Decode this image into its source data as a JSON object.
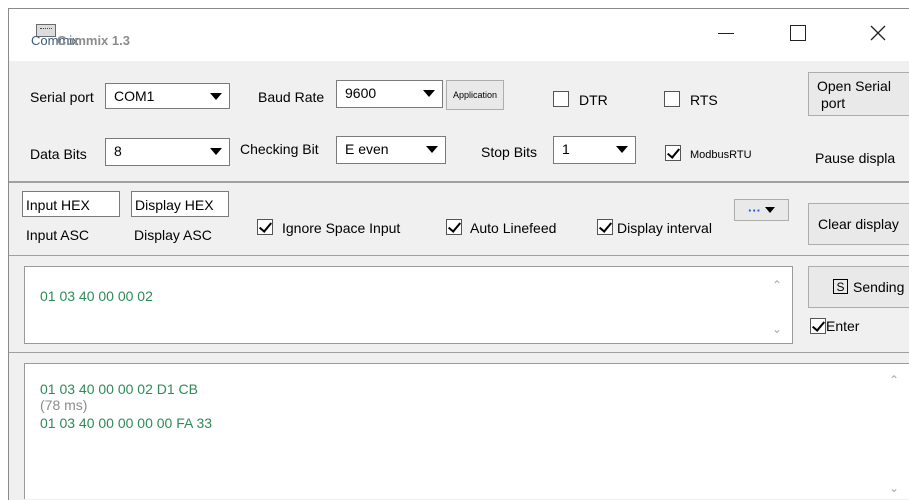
{
  "window": {
    "title_a": "Commix",
    "title_b": "Commix 1.3"
  },
  "controls": {
    "serial_port_label": "Serial port",
    "serial_port_value": "COM1",
    "baud_rate_label": "Baud Rate",
    "baud_rate_value": "9600",
    "application_label": "Application",
    "dtr_label": "DTR",
    "rts_label": "RTS",
    "open_serial_label_1": "Open Serial",
    "open_serial_label_2": "port",
    "data_bits_label": "Data Bits",
    "data_bits_value": "8",
    "checking_bit_label": "Checking Bit",
    "checking_bit_value": "E even",
    "stop_bits_label": "Stop Bits",
    "stop_bits_value": "1",
    "modbus_label": "ModbusRTU",
    "pause_label": "Pause displa"
  },
  "options": {
    "input_hex": "Input HEX",
    "input_asc": "Input ASC",
    "display_hex": "Display HEX",
    "display_asc": "Display ASC",
    "ignore_space": "Ignore Space Input",
    "auto_linefeed": "Auto Linefeed",
    "display_interval": "Display interval",
    "more_label": "···",
    "clear_display": "Clear display"
  },
  "send": {
    "input_text": "01 03 40 00 00 02",
    "sending_label": "Sending",
    "sending_key": "S",
    "enter_label": "Enter"
  },
  "receive": {
    "line1": "01 03 40 00 00 02 D1 CB",
    "line2": "(78 ms)",
    "line3": "01 03 40 00 00 00 00 FA 33"
  },
  "colors": {
    "data_green": "#2e8b57",
    "frame_bg": "#f0f0f0"
  }
}
